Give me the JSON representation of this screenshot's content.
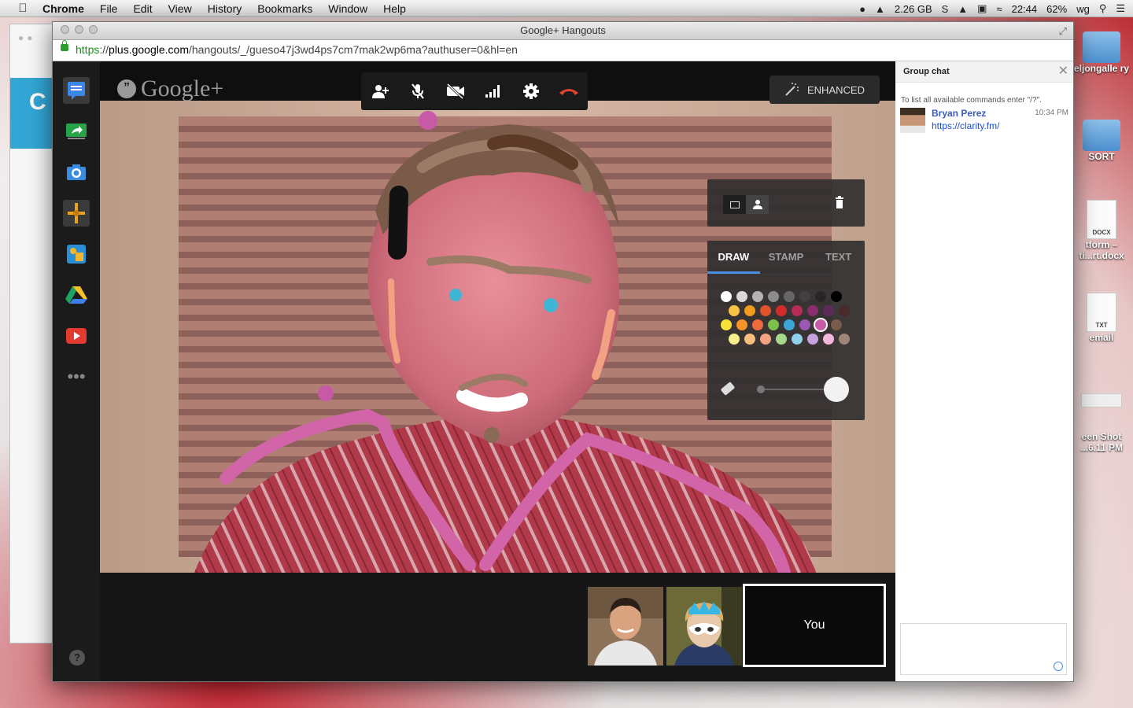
{
  "menubar": {
    "app": "Chrome",
    "items": [
      "File",
      "Edit",
      "View",
      "History",
      "Bookmarks",
      "Window",
      "Help"
    ],
    "memory": "2.26 GB",
    "time": "22:44",
    "battery": "62%",
    "user": "wg"
  },
  "desktop": {
    "items": [
      "eljongalle ry",
      "SORT",
      "tform – ti...rt.docx",
      "email",
      "een Shot ...6.11 PM"
    ],
    "doc_types": [
      "DOCX",
      "TXT"
    ]
  },
  "window": {
    "title": "Google+ Hangouts",
    "url_scheme": "https",
    "url_sep": "://",
    "url_host": "plus.google.com",
    "url_path": "/hangouts/_/gueso47j3wd4ps7cm7mak2wp6ma?authuser=0&hl=en"
  },
  "hangout": {
    "logo_text": "Google+",
    "enhanced_label": "ENHANCED",
    "toolbar_icons": [
      "add-person-icon",
      "mute-mic-icon",
      "camera-off-icon",
      "bandwidth-icon",
      "settings-icon",
      "hang-up-icon"
    ],
    "draw_panel": {
      "tabs": [
        "DRAW",
        "STAMP",
        "TEXT"
      ],
      "active_tab": "DRAW",
      "palette": [
        [
          "#ffffff",
          "#d9d9d9",
          "#b3b3b3",
          "#8c8c8c",
          "#666666",
          "#404040",
          "#262626",
          "#000000"
        ],
        [
          "#f6c343",
          "#f19a1b",
          "#e0532b",
          "#d12b2b",
          "#b82b56",
          "#8b2c6e",
          "#5e2a5c",
          "#4a2a2a"
        ],
        [
          "#f7e23a",
          "#f59229",
          "#ef6b3b",
          "#7cbf4a",
          "#3aa7d8",
          "#9b58b5",
          "#c65aa6",
          "#7a5a4a"
        ],
        [
          "#f6ee8a",
          "#f6c07c",
          "#f3a183",
          "#a6d98c",
          "#8fd2ec",
          "#c6a3de",
          "#f4b6dc",
          "#9e8577"
        ]
      ],
      "selected_color": "#c65aa6"
    },
    "you_label": "You"
  },
  "chat": {
    "title": "Group chat",
    "hint": "To list all available commands enter \"/?\".",
    "messages": [
      {
        "sender": "Bryan Perez",
        "time": "10:34 PM",
        "text": "https://clarity.fm/"
      }
    ]
  }
}
